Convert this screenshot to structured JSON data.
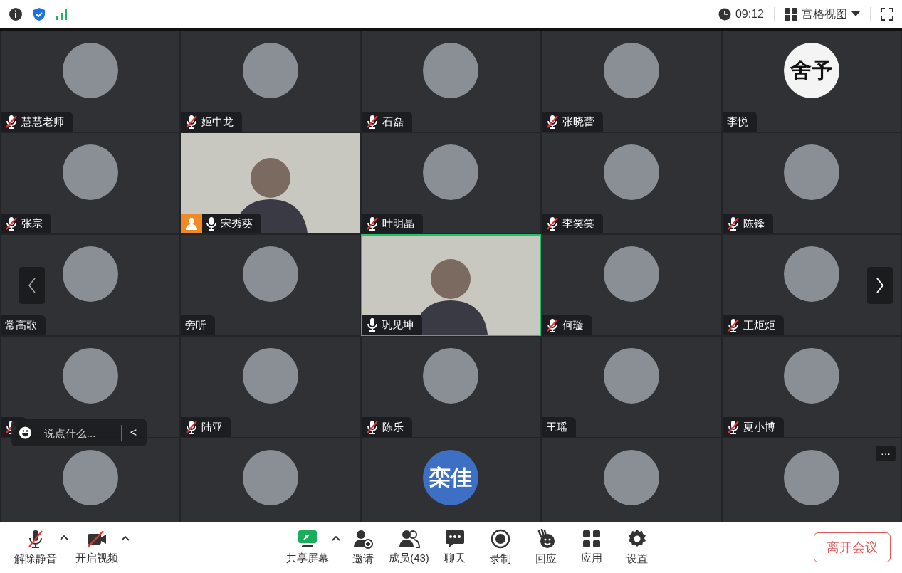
{
  "top_bar": {
    "time": "09:12",
    "view_mode": "宫格视图"
  },
  "tiles": [
    {
      "name": "慧慧老师",
      "kind": "avatar",
      "mic_visible": true,
      "muted": true,
      "speaking": false
    },
    {
      "name": "姬中龙",
      "kind": "avatar",
      "mic_visible": true,
      "muted": true,
      "speaking": false
    },
    {
      "name": "石磊",
      "kind": "avatar",
      "mic_visible": true,
      "muted": true,
      "speaking": false
    },
    {
      "name": "张晓蕾",
      "kind": "avatar",
      "mic_visible": true,
      "muted": true,
      "speaking": false
    },
    {
      "name": "李悦",
      "kind": "text_avatar",
      "avatar_text": "舍予",
      "color": "#f4f4f4",
      "mic_visible": false,
      "speaking": false
    },
    {
      "name": "张宗",
      "kind": "avatar",
      "mic_visible": true,
      "muted": true,
      "speaking": false
    },
    {
      "name": "宋秀葵",
      "kind": "video",
      "mic_visible": true,
      "muted": false,
      "host": true,
      "speaking": false
    },
    {
      "name": "叶明晶",
      "kind": "avatar",
      "mic_visible": true,
      "muted": true,
      "speaking": false
    },
    {
      "name": "李笑笑",
      "kind": "avatar",
      "mic_visible": true,
      "muted": true,
      "speaking": false
    },
    {
      "name": "陈锋",
      "kind": "avatar",
      "mic_visible": true,
      "muted": true,
      "speaking": false
    },
    {
      "name": "常高歌",
      "kind": "avatar",
      "mic_visible": false,
      "speaking": false
    },
    {
      "name": "旁听",
      "kind": "avatar",
      "mic_visible": false,
      "speaking": false
    },
    {
      "name": "巩见坤",
      "kind": "video",
      "mic_visible": true,
      "muted": false,
      "speaking": true
    },
    {
      "name": "何璇",
      "kind": "avatar",
      "mic_visible": true,
      "muted": true,
      "speaking": false
    },
    {
      "name": "王炬炬",
      "kind": "avatar",
      "mic_visible": true,
      "muted": true,
      "speaking": false
    },
    {
      "kind": "avatar",
      "mic_visible": true,
      "muted": true,
      "speaking": false
    },
    {
      "name": "陆亚",
      "kind": "avatar",
      "mic_visible": true,
      "muted": true,
      "speaking": false
    },
    {
      "name": "陈乐",
      "kind": "avatar",
      "mic_visible": true,
      "muted": true,
      "speaking": false
    },
    {
      "name": "王瑶",
      "kind": "avatar",
      "mic_visible": false,
      "speaking": false
    },
    {
      "name": "夏小博",
      "kind": "avatar",
      "mic_visible": true,
      "muted": true,
      "speaking": false
    },
    {
      "kind": "avatar",
      "speaking": false
    },
    {
      "kind": "avatar",
      "speaking": false
    },
    {
      "kind": "text_avatar",
      "avatar_text": "栾佳",
      "color": "#3d6fc4",
      "speaking": false
    },
    {
      "kind": "avatar",
      "speaking": false
    },
    {
      "kind": "avatar",
      "more": "···",
      "speaking": false
    }
  ],
  "chat_bar": {
    "placeholder": "说点什么...",
    "collapse": "<"
  },
  "toolbar": [
    {
      "label": "解除静音",
      "kind": "mic",
      "caret": true
    },
    {
      "label": "开启视频",
      "kind": "camera",
      "caret": true
    },
    {
      "label": "共享屏幕",
      "kind": "share",
      "caret": true
    },
    {
      "label": "邀请",
      "kind": "invite",
      "caret": false
    },
    {
      "label": "成员(43)",
      "kind": "members",
      "caret": false
    },
    {
      "label": "聊天",
      "kind": "chat",
      "caret": false
    },
    {
      "label": "录制",
      "kind": "record",
      "caret": false
    },
    {
      "label": "回应",
      "kind": "react",
      "caret": false
    },
    {
      "label": "应用",
      "kind": "apps",
      "caret": false
    },
    {
      "label": "设置",
      "kind": "settings",
      "caret": false
    }
  ],
  "leave_button": "离开会议"
}
